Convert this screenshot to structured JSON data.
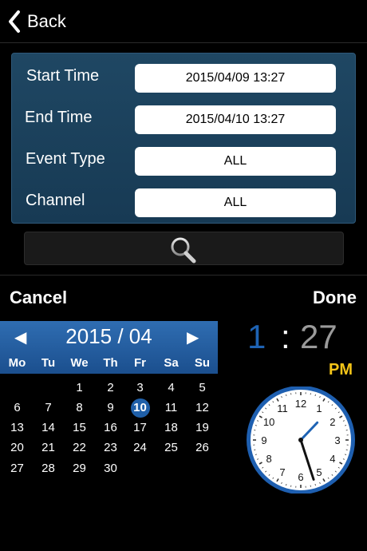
{
  "nav": {
    "back_label": "Back"
  },
  "filters": {
    "start_time_label": "Start Time",
    "start_time_value": "2015/04/09  13:27",
    "end_time_label": "End Time",
    "end_time_value": "2015/04/10  13:27",
    "event_type_label": "Event Type",
    "event_type_value": "ALL",
    "channel_label": "Channel",
    "channel_value": "ALL"
  },
  "picker": {
    "cancel_label": "Cancel",
    "done_label": "Done",
    "calendar": {
      "title": "2015 / 04",
      "prev_glyph": "◀",
      "next_glyph": "▶",
      "weekdays": [
        "Mo",
        "Tu",
        "We",
        "Th",
        "Fr",
        "Sa",
        "Su"
      ],
      "weeks": [
        [
          "",
          "",
          "1",
          "2",
          "3",
          "4",
          "5"
        ],
        [
          "6",
          "7",
          "8",
          "9",
          "10",
          "11",
          "12"
        ],
        [
          "13",
          "14",
          "15",
          "16",
          "17",
          "18",
          "19"
        ],
        [
          "20",
          "21",
          "22",
          "23",
          "24",
          "25",
          "26"
        ],
        [
          "27",
          "28",
          "29",
          "30",
          "",
          "",
          ""
        ]
      ],
      "selected_day": "10"
    },
    "time": {
      "hour": "1",
      "colon": ":",
      "minute": "27",
      "ampm": "PM"
    },
    "clock": {
      "numbers": [
        "12",
        "1",
        "2",
        "3",
        "4",
        "5",
        "6",
        "7",
        "8",
        "9",
        "10",
        "11"
      ],
      "hour_value": 13,
      "minute_value": 27,
      "hour_hand_color": "#1e63b4",
      "minute_hand_color": "#111111",
      "rim_color": "#1e5fb0"
    }
  },
  "icons": {
    "back": "chevron-left-icon",
    "search": "magnifier-icon"
  },
  "colors": {
    "panel": "#1f4763",
    "accent": "#1e63b4",
    "ampm": "#f5c518"
  }
}
